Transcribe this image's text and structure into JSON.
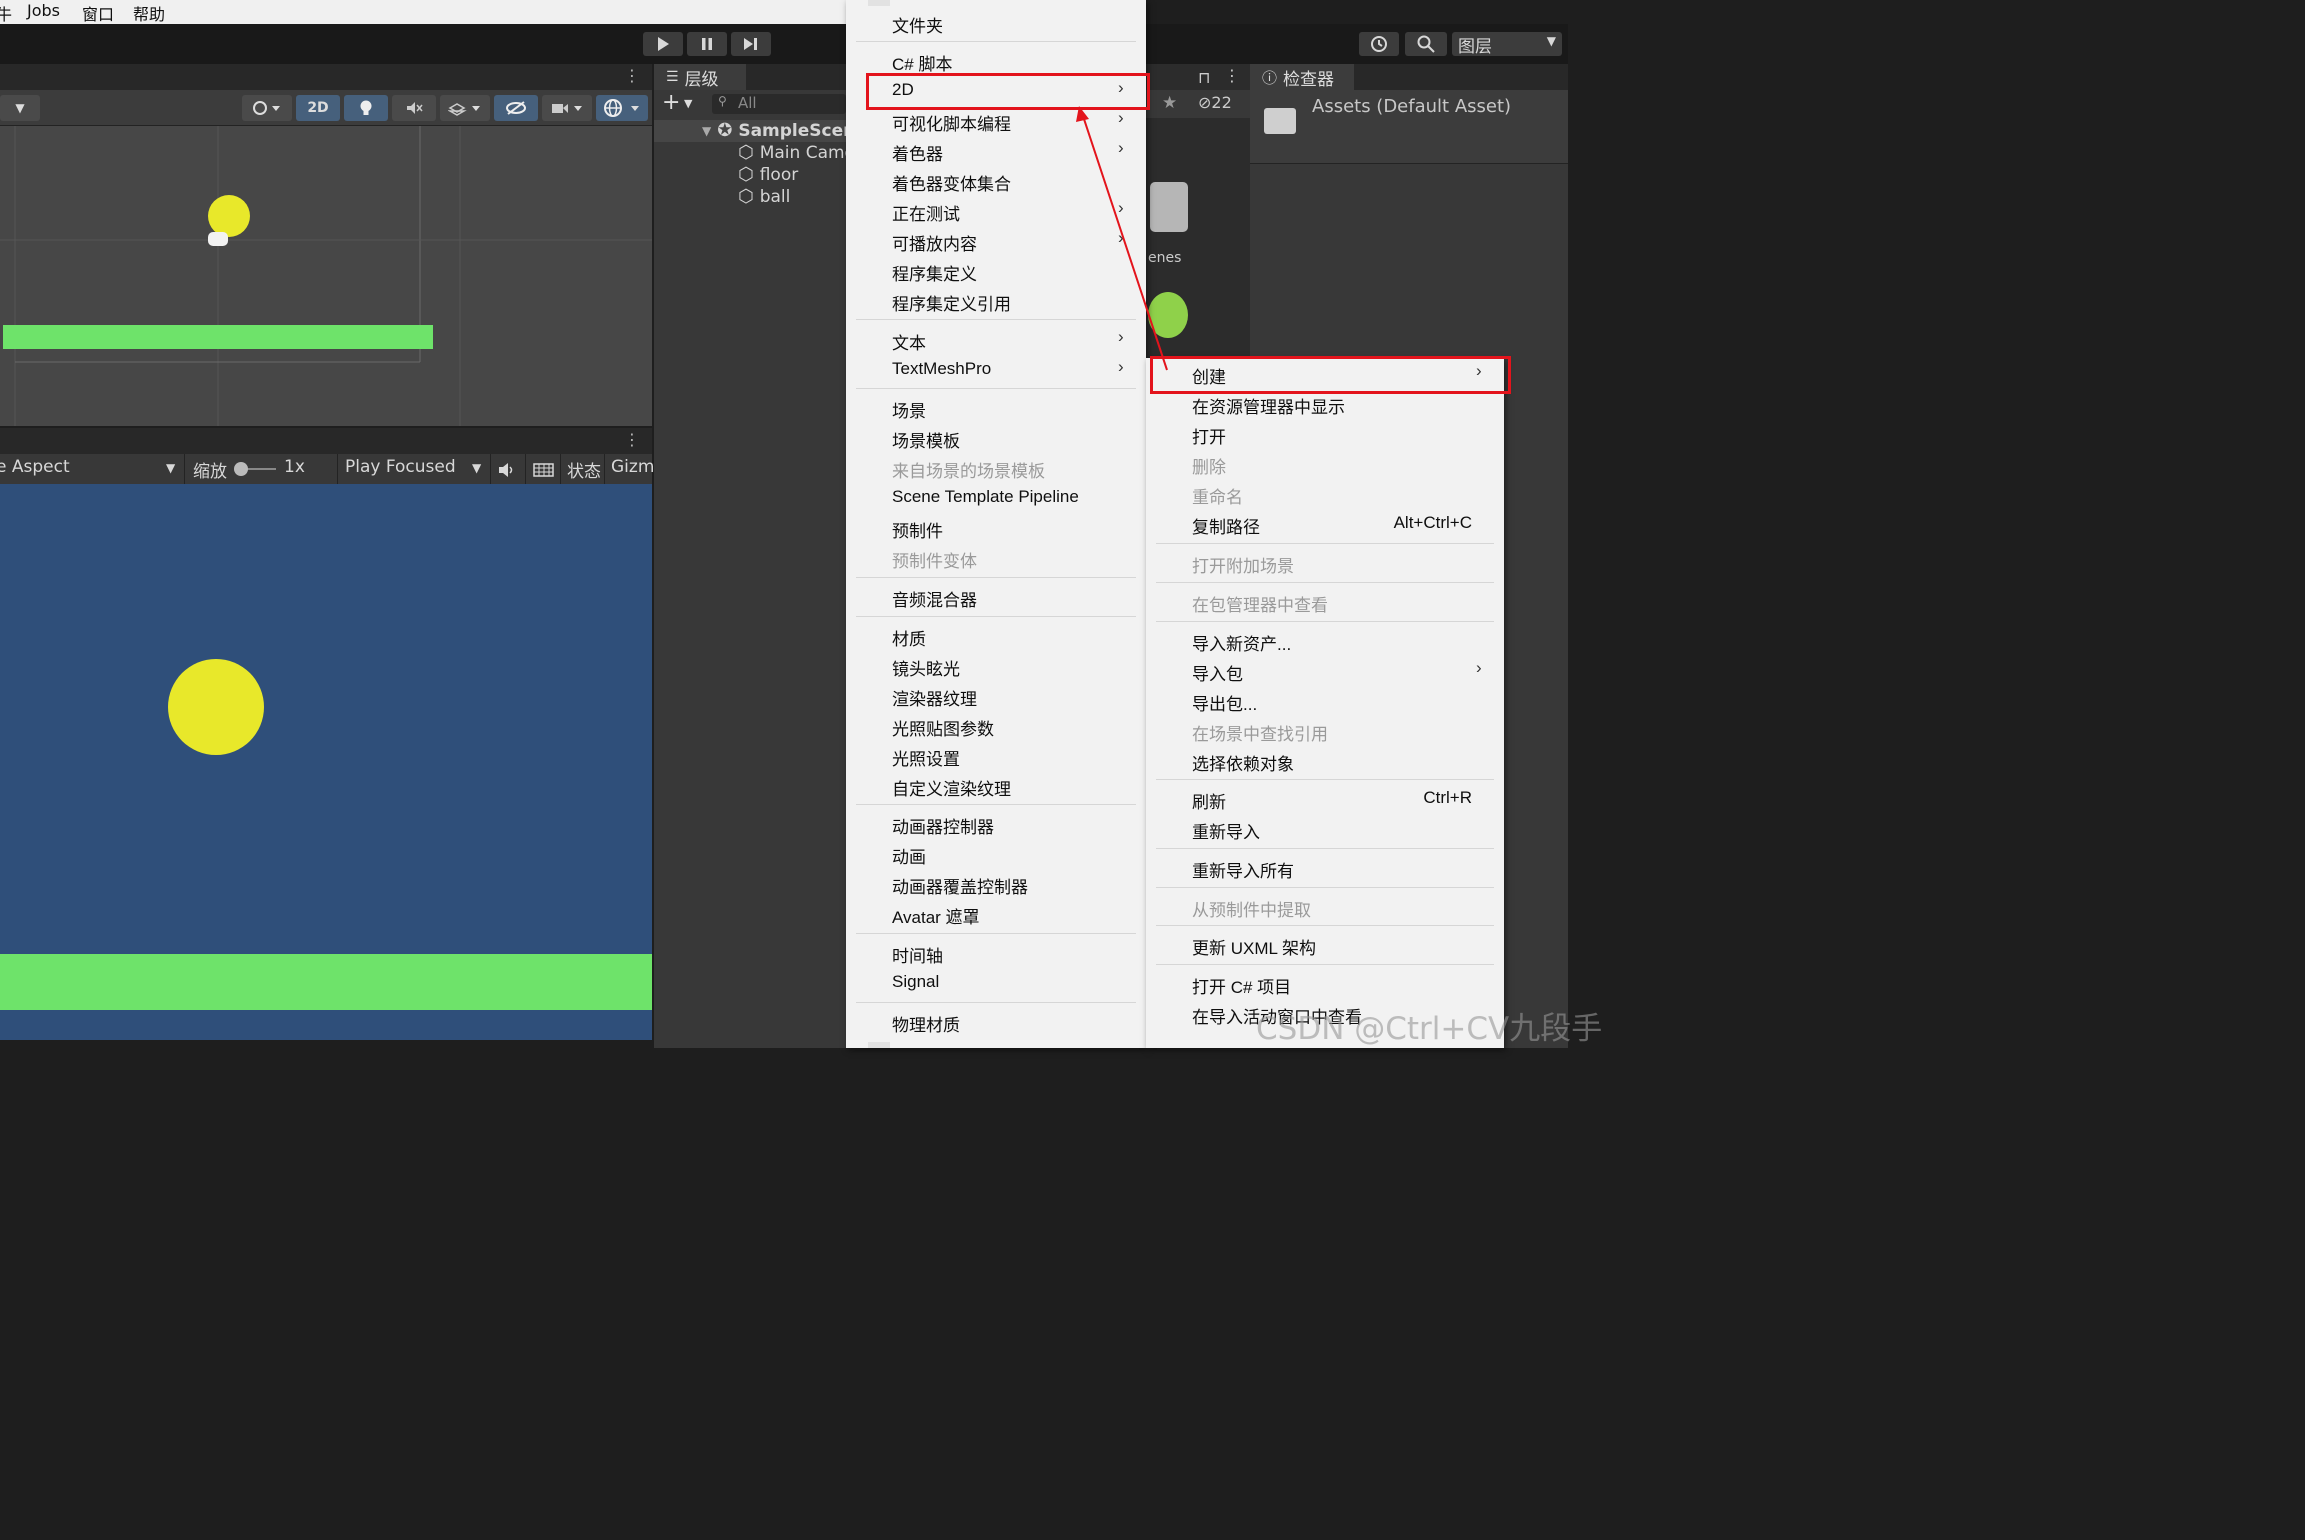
{
  "menubar": {
    "items": [
      "牛",
      "Jobs",
      "窗口",
      "帮助"
    ]
  },
  "toolbar": {
    "play_icon": "play-icon",
    "pause_icon": "pause-icon",
    "step_icon": "step-icon",
    "layers_label": "图层"
  },
  "scene": {
    "mode_2d_label": "2D",
    "ball_color": "#e8e82a",
    "floor_color": "#6ee36a"
  },
  "game": {
    "aspect_label": "e Aspect",
    "zoom_label": "缩放",
    "zoom_value": "1x",
    "play_focused_label": "Play Focused",
    "stats_label": "状态",
    "gizmos_label": "Gizm",
    "background_color": "#2f4f7a"
  },
  "hierarchy": {
    "tab_label": "层级",
    "search_placeholder": "All",
    "scene_name": "SampleScene",
    "items": [
      "Main Camera",
      "floor",
      "ball"
    ]
  },
  "project": {
    "hidden_count": "22",
    "folder_label": "enes"
  },
  "inspector": {
    "tab_label": "检查器",
    "title": "Assets (Default Asset)"
  },
  "create_menu": {
    "items": [
      {
        "label": "文件夹"
      },
      {
        "label": "C# 脚本"
      },
      {
        "label": "2D",
        "submenu": true
      },
      {
        "label": "可视化脚本编程",
        "submenu": true
      },
      {
        "label": "着色器",
        "submenu": true
      },
      {
        "label": "着色器变体集合"
      },
      {
        "label": "正在测试",
        "submenu": true
      },
      {
        "label": "可播放内容",
        "submenu": true
      },
      {
        "label": "程序集定义"
      },
      {
        "label": "程序集定义引用"
      },
      {
        "label": "文本",
        "submenu": true
      },
      {
        "label": "TextMeshPro",
        "submenu": true
      },
      {
        "label": "场景"
      },
      {
        "label": "场景模板"
      },
      {
        "label": "来自场景的场景模板",
        "disabled": true
      },
      {
        "label": "Scene Template Pipeline"
      },
      {
        "label": "预制件"
      },
      {
        "label": "预制件变体",
        "disabled": true
      },
      {
        "label": "音频混合器"
      },
      {
        "label": "材质"
      },
      {
        "label": "镜头眩光"
      },
      {
        "label": "渲染器纹理"
      },
      {
        "label": "光照贴图参数"
      },
      {
        "label": "光照设置"
      },
      {
        "label": "自定义渲染纹理"
      },
      {
        "label": "动画器控制器"
      },
      {
        "label": "动画"
      },
      {
        "label": "动画器覆盖控制器"
      },
      {
        "label": "Avatar 遮罩"
      },
      {
        "label": "时间轴"
      },
      {
        "label": "Signal"
      },
      {
        "label": "物理材质"
      }
    ]
  },
  "context_menu": {
    "items": [
      {
        "label": "创建",
        "submenu": true
      },
      {
        "label": "在资源管理器中显示"
      },
      {
        "label": "打开"
      },
      {
        "label": "删除",
        "disabled": true
      },
      {
        "label": "重命名",
        "disabled": true
      },
      {
        "label": "复制路径",
        "shortcut": "Alt+Ctrl+C"
      },
      {
        "label": "打开附加场景",
        "disabled": true
      },
      {
        "label": "在包管理器中查看",
        "disabled": true
      },
      {
        "label": "导入新资产..."
      },
      {
        "label": "导入包",
        "submenu": true
      },
      {
        "label": "导出包..."
      },
      {
        "label": "在场景中查找引用",
        "disabled": true
      },
      {
        "label": "选择依赖对象"
      },
      {
        "label": "刷新",
        "shortcut": "Ctrl+R"
      },
      {
        "label": "重新导入"
      },
      {
        "label": "重新导入所有"
      },
      {
        "label": "从预制件中提取",
        "disabled": true
      },
      {
        "label": "更新 UXML 架构"
      },
      {
        "label": "打开 C# 项目"
      },
      {
        "label": "在导入活动窗口中查看"
      }
    ]
  },
  "annotation": {
    "highlight_color": "#e3141c"
  },
  "watermark": "CSDN @Ctrl+CV九段手"
}
